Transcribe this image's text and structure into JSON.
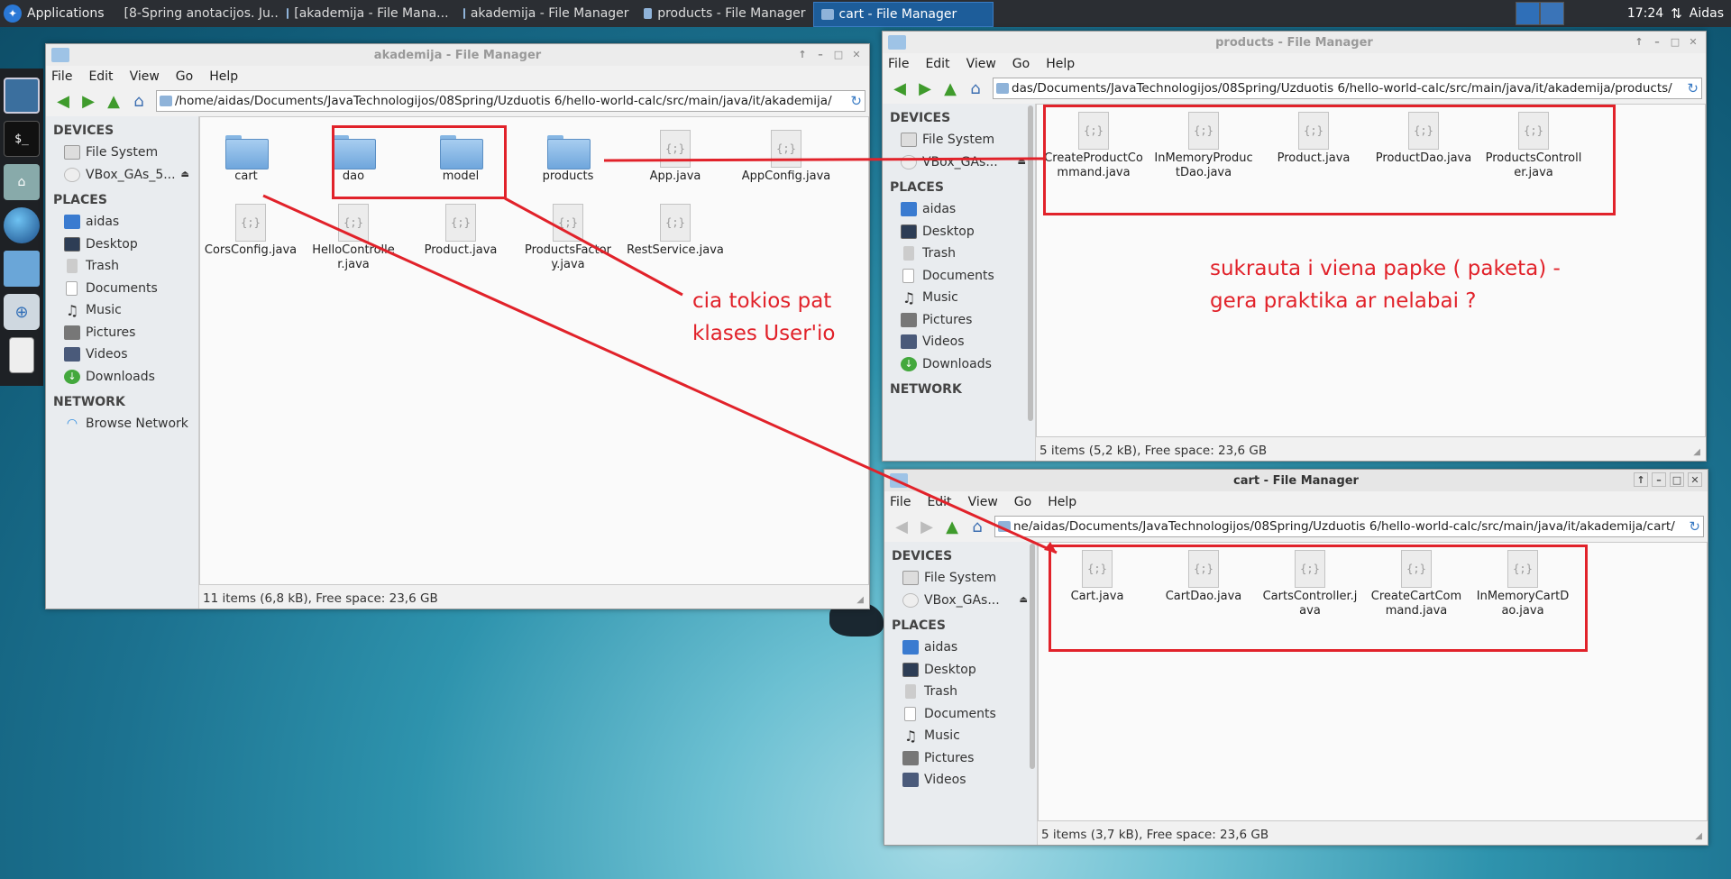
{
  "panel": {
    "applications_label": "Applications",
    "tasks": [
      {
        "label": "[8-Spring anotacijos. Ju...",
        "icon": "browser-icon"
      },
      {
        "label": "[akademija - File Mana...",
        "icon": "folder-icon"
      },
      {
        "label": "akademija - File Manager",
        "icon": "folder-icon"
      },
      {
        "label": "products - File Manager",
        "icon": "folder-icon"
      },
      {
        "label": "cart - File Manager",
        "icon": "folder-icon"
      }
    ],
    "clock": "17:24",
    "user": "Aidas"
  },
  "menu_labels": [
    "File",
    "Edit",
    "View",
    "Go",
    "Help"
  ],
  "sidebar_labels": {
    "devices": "DEVICES",
    "places": "PLACES",
    "network": "NETWORK",
    "file_system": "File System",
    "vbox_long": "VBox_GAs_5...",
    "vbox_short": "VBox_GAs...",
    "aidas": "aidas",
    "desktop": "Desktop",
    "trash": "Trash",
    "documents": "Documents",
    "music": "Music",
    "pictures": "Pictures",
    "videos": "Videos",
    "downloads": "Downloads",
    "browse_network": "Browse Network"
  },
  "akademija": {
    "title": "akademija - File Manager",
    "path": "/home/aidas/Documents/JavaTechnologijos/08Spring/Uzduotis 6/hello-world-calc/src/main/java/it/akademija/",
    "files": [
      "cart",
      "dao",
      "model",
      "products",
      "App.java",
      "AppConfig.java",
      "CorsConfig.java",
      "HelloController.java",
      "Product.java",
      "ProductsFactory.java",
      "RestService.java"
    ],
    "status": "11 items (6,8 kB), Free space: 23,6 GB"
  },
  "products": {
    "title": "products - File Manager",
    "path": "das/Documents/JavaTechnologijos/08Spring/Uzduotis 6/hello-world-calc/src/main/java/it/akademija/products/",
    "files": [
      "CreateProductCommand.java",
      "InMemoryProductDao.java",
      "Product.java",
      "ProductDao.java",
      "ProductsController.java"
    ],
    "status": "5 items (5,2 kB), Free space: 23,6 GB"
  },
  "cart": {
    "title": "cart - File Manager",
    "path": "ne/aidas/Documents/JavaTechnologijos/08Spring/Uzduotis 6/hello-world-calc/src/main/java/it/akademija/cart/",
    "files": [
      "Cart.java",
      "CartDao.java",
      "CartsController.java",
      "CreateCartCommand.java",
      "InMemoryCartDao.java"
    ],
    "status": "5 items (3,7 kB), Free space: 23,6 GB"
  },
  "annotations": {
    "note1_line1": "cia tokios pat",
    "note1_line2": "klases User'io",
    "note2_line1": "sukrauta i viena papke   ( paketa)  -",
    "note2_line2": "gera praktika ar nelabai ?",
    "color": "#e1222a"
  },
  "file_icon_glyph": "{;}"
}
